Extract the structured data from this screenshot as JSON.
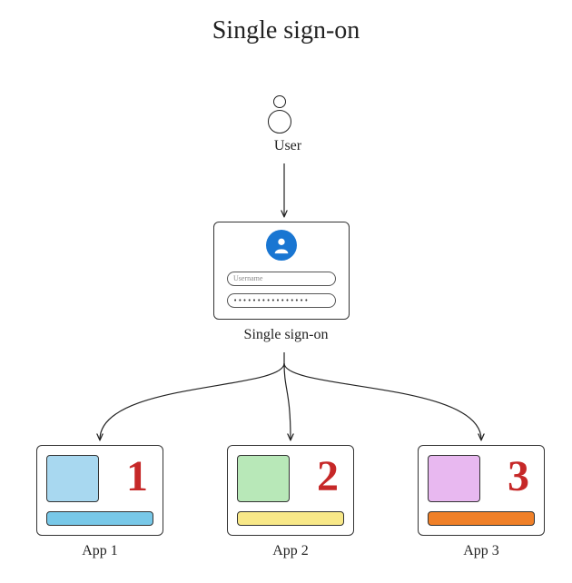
{
  "title": "Single sign-on",
  "user": {
    "label": "User"
  },
  "sso": {
    "label": "Single sign-on",
    "username_placeholder": "Username",
    "password_value": "••••••••••••••••"
  },
  "apps": [
    {
      "label": "App 1",
      "number": "1",
      "square_color": "#a8d8f0",
      "bar_color": "#78c8e8"
    },
    {
      "label": "App 2",
      "number": "2",
      "square_color": "#b8e8b8",
      "bar_color": "#f8e888"
    },
    {
      "label": "App 3",
      "number": "3",
      "square_color": "#e8b8f0",
      "bar_color": "#f08028"
    }
  ]
}
